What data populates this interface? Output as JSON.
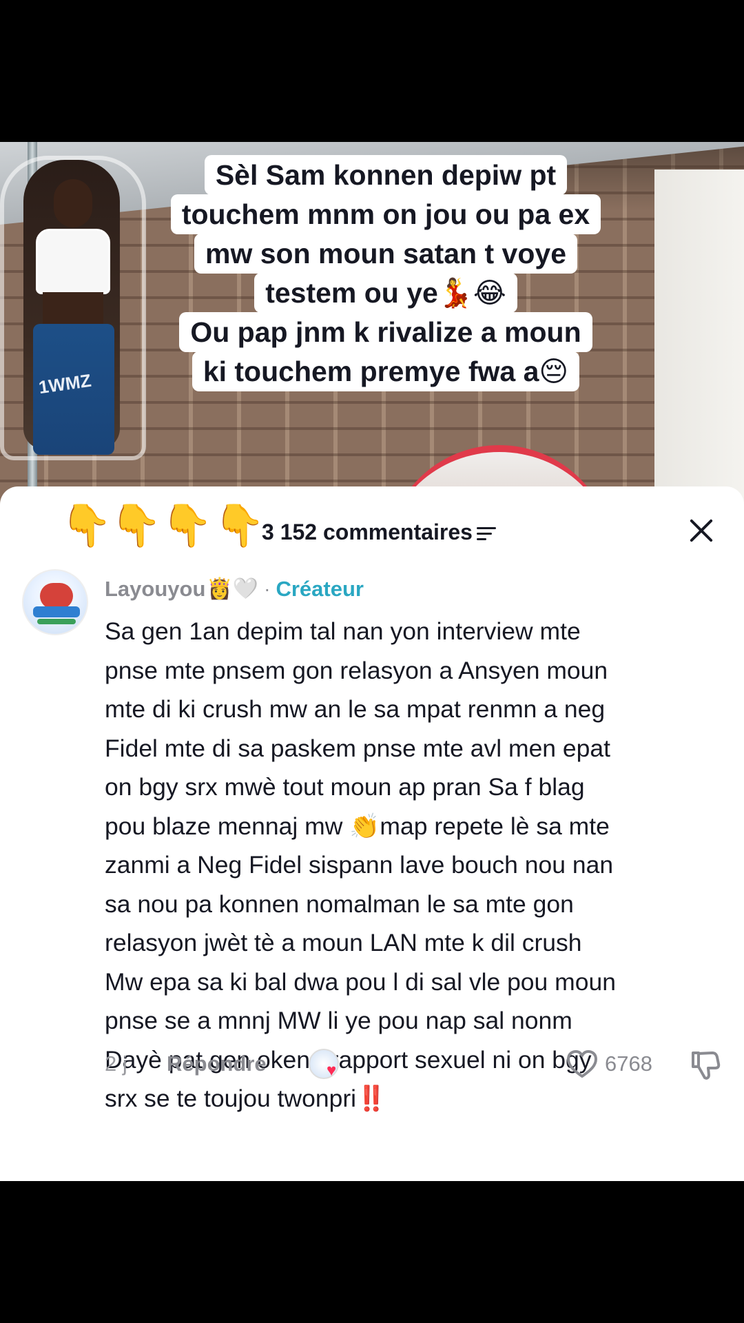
{
  "caption": {
    "lines": [
      "Sèl Sam konnen depiw pt",
      "touchem mnm on jou ou pa ex",
      "mw son moun satan t voye",
      "testem ou ye💃😂",
      "Ou pap jnm k rivalize a moun",
      "ki touchem premye fwa a😔"
    ]
  },
  "person": {
    "pants_text": "1WMZ"
  },
  "comments_sheet": {
    "header_emojis": [
      "👇",
      "👇",
      "👇",
      "👇"
    ],
    "comment_count": "3 152 commentaires",
    "close_icon": "close-icon",
    "sort_icon": "sort-icon"
  },
  "comment": {
    "username": "Layouyou",
    "username_emojis": "👸🤍",
    "separator": "·",
    "creator_label": "Créateur",
    "body_lines": [
      "Sa gen 1an depim tal nan yon interview mte",
      "pnse mte pnsem gon relasyon a Ansyen moun",
      "mte di ki crush mw an le sa mpat renmn a neg",
      "Fidel mte di sa paskem pnse mte avl men epat",
      "on bgy srx mwè tout moun ap pran Sa f blag",
      "pou blaze mennaj mw 👏map repete lè sa mte",
      "zanmi a Neg Fidel sispann lave bouch nou nan",
      "sa nou pa konnen nomalman le sa mte gon",
      "relasyon jwèt tè a moun LAN mte k dil crush",
      "Mw epa sa ki bal dwa pou l di sal vle pou moun",
      "pnse se a mnnj MW li ye pou nap sal nonm",
      "Dayè pat gen okenn rapport sexuel ni on bgy",
      "srx se te toujou twonpri‼️"
    ],
    "age": "2 j",
    "reply_label": "Répondre",
    "like_count": "6768",
    "liked_heart": "♥"
  },
  "colors": {
    "text_primary": "#161823",
    "text_secondary": "#8a8b91",
    "creator_accent": "#2aa7c2",
    "heart_accent": "#fe2c55"
  }
}
